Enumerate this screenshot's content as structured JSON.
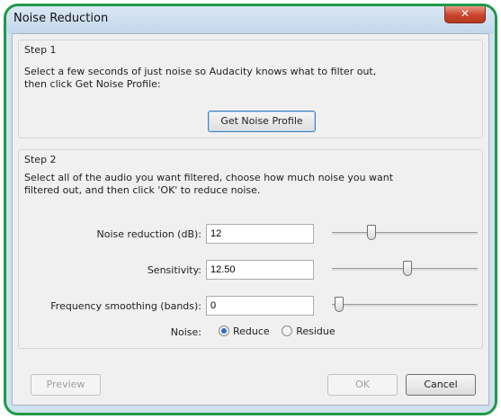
{
  "window": {
    "title": "Noise Reduction",
    "close_icon": "✕"
  },
  "step1": {
    "heading": "Step 1",
    "line1": "Select a few seconds of just noise so Audacity knows what to filter out,",
    "line2": "then click Get Noise Profile:",
    "button_label": "Get Noise Profile"
  },
  "step2": {
    "heading": "Step 2",
    "line1": "Select all of the audio you want filtered, choose how much noise you want",
    "line2": "filtered out, and then click 'OK' to reduce noise.",
    "fields": [
      {
        "label": "Noise reduction (dB):",
        "value": "12",
        "slider_fraction": 0.27
      },
      {
        "label": "Sensitivity:",
        "value": "12.50",
        "slider_fraction": 0.52
      },
      {
        "label": "Frequency smoothing (bands):",
        "value": "0",
        "slider_fraction": 0.05
      }
    ],
    "noise_label": "Noise:",
    "noise_options": [
      "Reduce",
      "Residue"
    ],
    "noise_selected": "Reduce"
  },
  "buttons": {
    "preview": "Preview",
    "ok": "OK",
    "cancel": "Cancel"
  }
}
